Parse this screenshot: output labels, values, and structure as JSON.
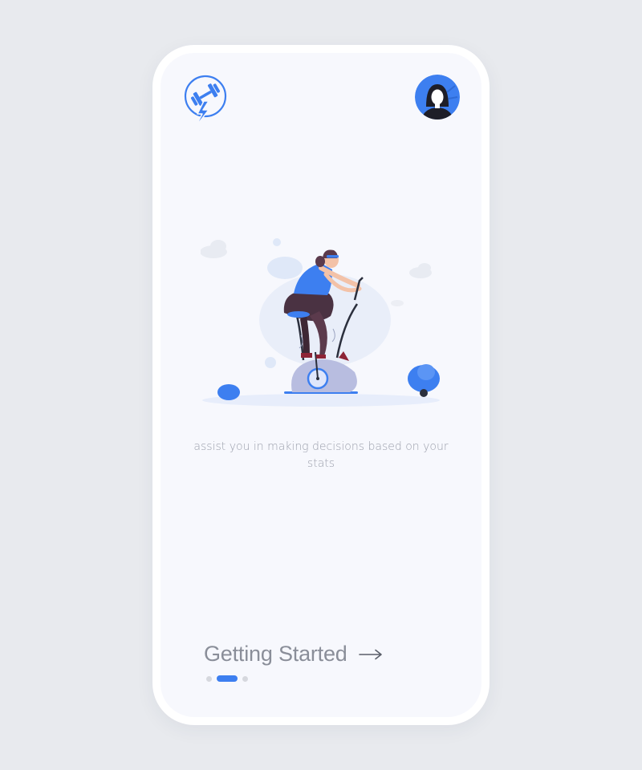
{
  "onboarding": {
    "tagline": "assist you in making decisions based on your stats",
    "cta_label": "Getting Started",
    "pager": {
      "total": 3,
      "active_index": 1
    }
  },
  "icons": {
    "logo": "dumbbell-lightning-icon",
    "avatar": "user-avatar",
    "cta": "arrow-right-icon"
  },
  "colors": {
    "accent": "#3d7ff0",
    "background": "#f7f8fd",
    "text_muted": "#9da1ad"
  }
}
